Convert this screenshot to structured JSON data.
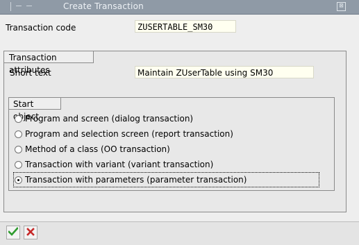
{
  "window": {
    "title": "Create Transaction",
    "close_glyph": "⊠"
  },
  "form": {
    "transaction_code_label": "Transaction code",
    "transaction_code_value": "ZUSERTABLE_SM30"
  },
  "attributes": {
    "legend": "Transaction attributes",
    "short_text_label": "Short text",
    "short_text_value": "Maintain ZUserTable using SM30"
  },
  "start_object": {
    "legend": "Start object",
    "options": [
      {
        "label": "Program and screen (dialog transaction)",
        "selected": false
      },
      {
        "label": "Program and selection screen (report transaction)",
        "selected": false
      },
      {
        "label": "Method of a class (OO transaction)",
        "selected": false
      },
      {
        "label": "Transaction with variant (variant transaction)",
        "selected": false
      },
      {
        "label": "Transaction with parameters (parameter transaction)",
        "selected": true
      }
    ]
  },
  "toolbar": {
    "confirm_icon": "check-icon",
    "cancel_icon": "cross-icon"
  },
  "colors": {
    "titlebar": "#8f9aa6",
    "input_bg": "#fffff0",
    "confirm_green": "#2e9b2e",
    "cancel_red": "#c62828"
  }
}
